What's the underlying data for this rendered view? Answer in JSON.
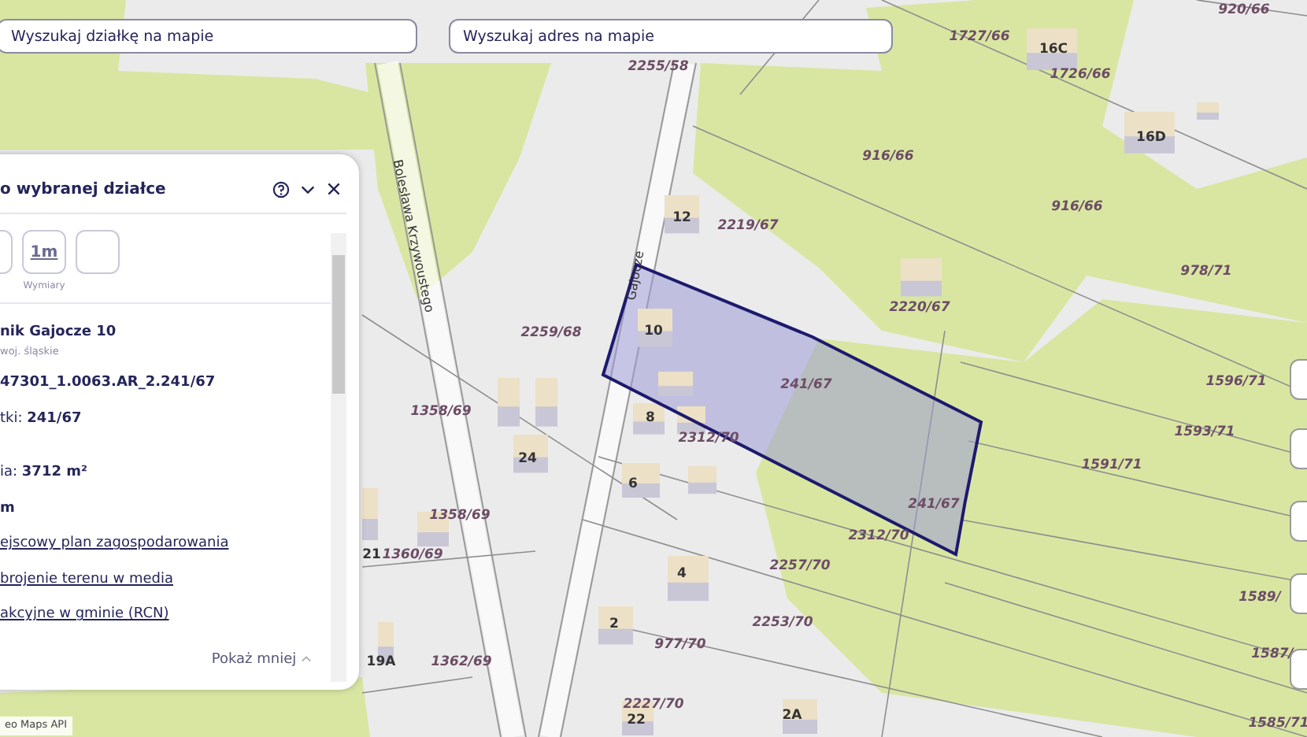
{
  "search_fields": [
    {
      "placeholder": "Wyszukaj działkę na mapie"
    },
    {
      "placeholder": "Wyszukaj adres na mapie"
    }
  ],
  "map": {
    "street_names": [
      "Bolesława Krzywoustego",
      "Gajocze"
    ],
    "parcel_numbers": [
      "2255/58",
      "1727/66",
      "1726/66",
      "920/66",
      "916/66",
      "916/66",
      "978/71",
      "2219/67",
      "2220/67",
      "2259/68",
      "241/67",
      "1596/71",
      "1358/69",
      "1593/71",
      "2312/70",
      "1591/71",
      "1358/69",
      "241/67",
      "2312/70",
      "1360/69",
      "2257/70",
      "1589/",
      "2253/70",
      "977/70",
      "1362/69",
      "1587/",
      "2227/70",
      "1585/71"
    ],
    "house_numbers": [
      "16C",
      "16D",
      "12",
      "10",
      "8",
      "24",
      "6",
      "4",
      "2",
      "19A",
      "2A",
      "22",
      "21"
    ],
    "attribution": "eo Maps API"
  },
  "panel": {
    "title": "o wybranej działce",
    "tools": [
      {
        "kind": "edge"
      },
      {
        "kind": "measure",
        "icon_text": "1m",
        "label": "Wymiary"
      },
      {
        "kind": "partial"
      }
    ],
    "details": [
      {
        "kind": "title",
        "text": "nik Gajocze 10"
      },
      {
        "kind": "subtitle",
        "text": "woj. śląskie"
      },
      {
        "kind": "plain",
        "text": "47301_1.0063.AR_2.241/67"
      },
      {
        "kind": "field",
        "label": "tki:",
        "value": "241/67"
      },
      {
        "kind": "field",
        "label": "ia:",
        "value": "3712 m²"
      },
      {
        "kind": "plain",
        "text": "m"
      },
      {
        "kind": "link",
        "text": "ejscowy plan zagospodarowania"
      },
      {
        "kind": "link",
        "text": "brojenie terenu w media"
      },
      {
        "kind": "link",
        "text": "akcyjne w gminie (RCN)"
      }
    ],
    "toggle": "Pokaż mniej"
  }
}
